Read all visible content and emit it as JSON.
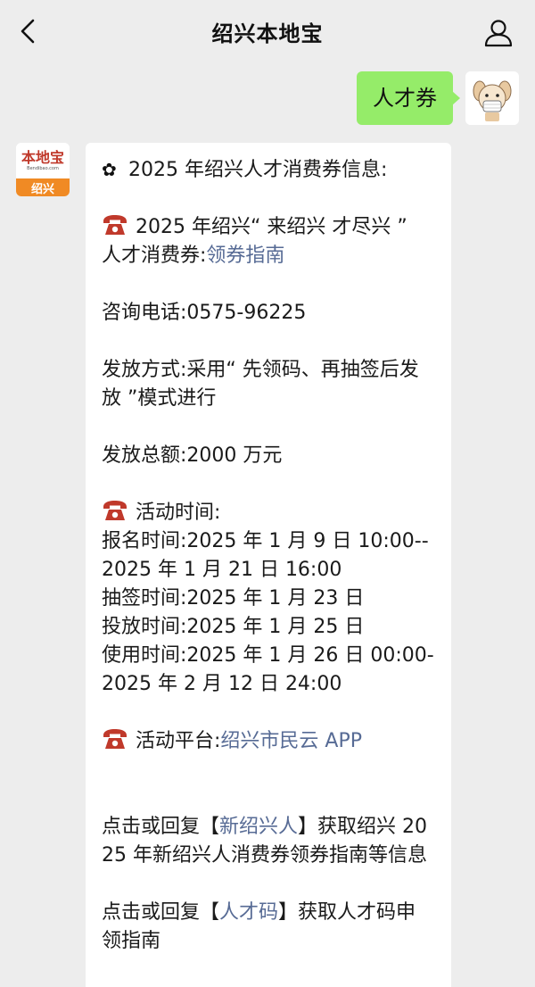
{
  "header": {
    "title": "绍兴本地宝"
  },
  "outgoing": {
    "text": "人才券"
  },
  "account": {
    "logo_main": "本地宝",
    "logo_sub": "Bendibao.com",
    "logo_city": "绍兴"
  },
  "message": {
    "heading": "2025 年绍兴人才消费券信息:",
    "coupon_line1": "2025 年绍兴“ 来绍兴 才尽兴 ”",
    "coupon_line2_prefix": "人才消费券:",
    "guide_link": "领券指南",
    "consult": "咨询电话:0575-96225",
    "method": "发放方式:采用“ 先领码、再抽签后发放 ”模式进行",
    "total": "发放总额:2000 万元",
    "time_heading": "活动时间:",
    "signup": "报名时间:2025 年 1 月 9 日 10:00--2025 年 1 月 21 日 16:00",
    "lottery": "抽签时间:2025 年 1 月 23 日",
    "release": "投放时间:2025 年 1 月 25 日",
    "usage": "使用时间:2025 年 1 月 26 日 00:00-2025 年 2 月 12 日 24:00",
    "platform_prefix": "活动平台:",
    "platform_link": "绍兴市民云 APP",
    "reply1_prefix": "点击或回复【",
    "reply1_link": "新绍兴人",
    "reply1_suffix": "】获取绍兴 2025 年新绍兴人消费券领券指南等信息",
    "reply2_prefix": "点击或回复【",
    "reply2_link": "人才码",
    "reply2_suffix": "】获取人才码申领指南"
  },
  "icons": {
    "back": "chevron-left-icon",
    "profile": "person-icon",
    "phone": "telephone-icon",
    "flower": "flower-icon"
  },
  "colors": {
    "background": "#ededed",
    "bubble_out": "#95ec69",
    "link": "#576b95",
    "phone_icon": "#c0392b",
    "logo_orange": "#f08a24"
  }
}
